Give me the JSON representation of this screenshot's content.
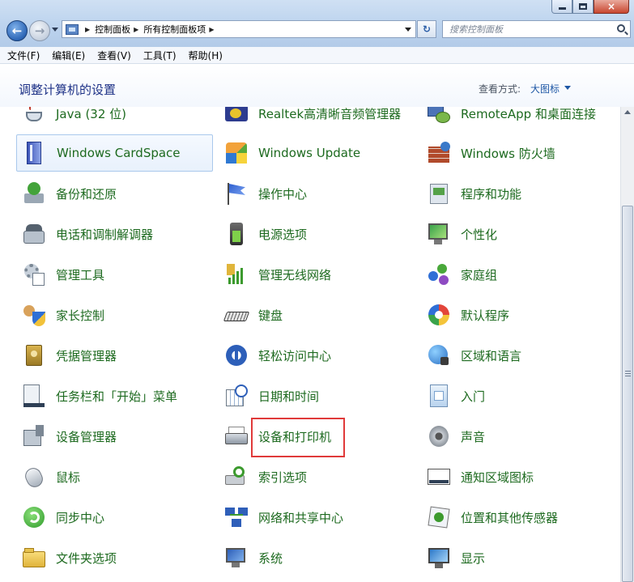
{
  "window": {
    "caption_buttons": {
      "minimize": "minimize",
      "maximize": "maximize",
      "close": "×"
    }
  },
  "nav": {
    "back_glyph": "←",
    "forward_glyph": "→",
    "breadcrumb": [
      "控制面板",
      "所有控制面板项"
    ],
    "refresh_glyph": "↻",
    "search_placeholder": "搜索控制面板"
  },
  "menu": [
    "文件(F)",
    "编辑(E)",
    "查看(V)",
    "工具(T)",
    "帮助(H)"
  ],
  "header": {
    "title": "调整计算机的设置",
    "view_label": "查看方式:",
    "view_value": "大图标"
  },
  "items": [
    {
      "label": "Java (32 位)",
      "icon": "java-icon",
      "col": 0,
      "row": 0
    },
    {
      "label": "Realtek高清晰音频管理器",
      "icon": "realtek-audio-icon",
      "col": 1,
      "row": 0
    },
    {
      "label": "RemoteApp 和桌面连接",
      "icon": "remoteapp-icon",
      "col": 2,
      "row": 0
    },
    {
      "label": "Windows CardSpace",
      "icon": "cardspace-icon",
      "col": 0,
      "row": 1,
      "selected": true
    },
    {
      "label": "Windows Update",
      "icon": "windows-update-icon",
      "col": 1,
      "row": 1
    },
    {
      "label": "Windows 防火墙",
      "icon": "firewall-icon",
      "col": 2,
      "row": 1
    },
    {
      "label": "备份和还原",
      "icon": "backup-restore-icon",
      "col": 0,
      "row": 2
    },
    {
      "label": "操作中心",
      "icon": "action-center-flag-icon",
      "col": 1,
      "row": 2
    },
    {
      "label": "程序和功能",
      "icon": "programs-features-icon",
      "col": 2,
      "row": 2
    },
    {
      "label": "电话和调制解调器",
      "icon": "phone-modem-icon",
      "col": 0,
      "row": 3
    },
    {
      "label": "电源选项",
      "icon": "power-options-icon",
      "col": 1,
      "row": 3
    },
    {
      "label": "个性化",
      "icon": "personalization-icon",
      "col": 2,
      "row": 3
    },
    {
      "label": "管理工具",
      "icon": "admin-tools-icon",
      "col": 0,
      "row": 4
    },
    {
      "label": "管理无线网络",
      "icon": "wireless-network-icon",
      "col": 1,
      "row": 4
    },
    {
      "label": "家庭组",
      "icon": "homegroup-icon",
      "col": 2,
      "row": 4
    },
    {
      "label": "家长控制",
      "icon": "parental-controls-icon",
      "col": 0,
      "row": 5
    },
    {
      "label": "键盘",
      "icon": "keyboard-icon",
      "col": 1,
      "row": 5
    },
    {
      "label": "默认程序",
      "icon": "default-programs-icon",
      "col": 2,
      "row": 5
    },
    {
      "label": "凭据管理器",
      "icon": "credential-manager-icon",
      "col": 0,
      "row": 6
    },
    {
      "label": "轻松访问中心",
      "icon": "ease-of-access-icon",
      "col": 1,
      "row": 6
    },
    {
      "label": "区域和语言",
      "icon": "region-language-icon",
      "col": 2,
      "row": 6
    },
    {
      "label": "任务栏和「开始」菜单",
      "icon": "taskbar-start-icon",
      "col": 0,
      "row": 7
    },
    {
      "label": "日期和时间",
      "icon": "date-time-icon",
      "col": 1,
      "row": 7
    },
    {
      "label": "入门",
      "icon": "getting-started-icon",
      "col": 2,
      "row": 7
    },
    {
      "label": "设备管理器",
      "icon": "device-manager-icon",
      "col": 0,
      "row": 8
    },
    {
      "label": "设备和打印机",
      "icon": "devices-printers-icon",
      "col": 1,
      "row": 8,
      "highlighted": true
    },
    {
      "label": "声音",
      "icon": "sound-icon",
      "col": 2,
      "row": 8
    },
    {
      "label": "鼠标",
      "icon": "mouse-icon",
      "col": 0,
      "row": 9
    },
    {
      "label": "索引选项",
      "icon": "indexing-options-icon",
      "col": 1,
      "row": 9
    },
    {
      "label": "通知区域图标",
      "icon": "notification-area-icon",
      "col": 2,
      "row": 9
    },
    {
      "label": "同步中心",
      "icon": "sync-center-icon",
      "col": 0,
      "row": 10
    },
    {
      "label": "网络和共享中心",
      "icon": "network-sharing-icon",
      "col": 1,
      "row": 10
    },
    {
      "label": "位置和其他传感器",
      "icon": "location-sensors-icon",
      "col": 2,
      "row": 10
    },
    {
      "label": "文件夹选项",
      "icon": "folder-options-icon",
      "col": 0,
      "row": 11
    },
    {
      "label": "系统",
      "icon": "system-icon",
      "col": 1,
      "row": 11
    },
    {
      "label": "显示",
      "icon": "display-icon",
      "col": 2,
      "row": 11
    }
  ],
  "colors": {
    "item_text": "#1d6a1f",
    "title_text": "#1e3287",
    "highlight_border": "#e03a3a"
  }
}
